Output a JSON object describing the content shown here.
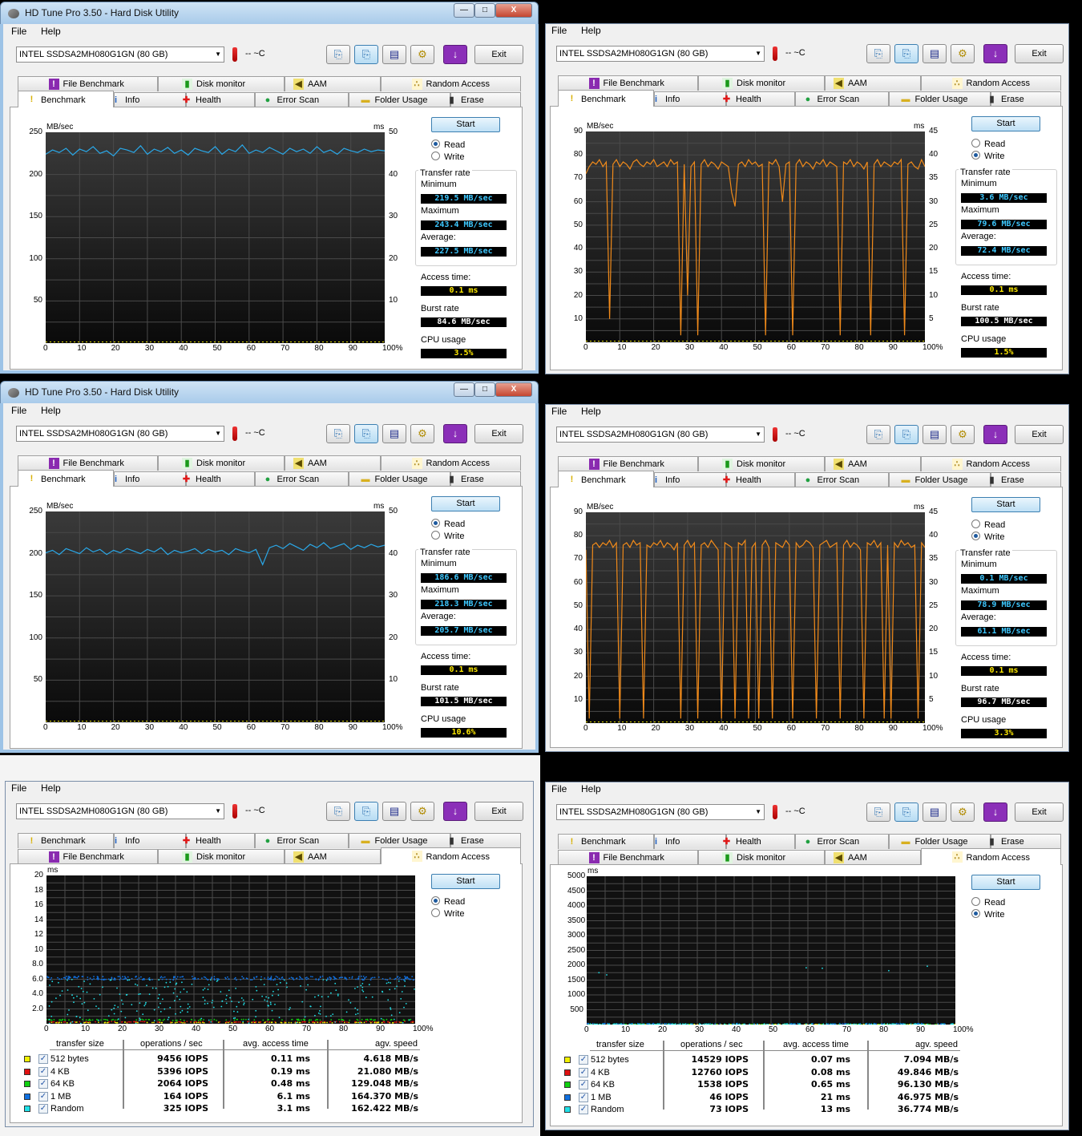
{
  "window_title": "HD Tune Pro 3.50 - Hard Disk Utility",
  "window_buttons": {
    "minimize": "—",
    "maximize": "□",
    "close": "X"
  },
  "menu": {
    "file": "File",
    "help": "Help"
  },
  "toolbar": {
    "drive": "INTEL SSDSA2MH080G1GN (80 GB)",
    "temp": "-- ~C",
    "exit": "Exit",
    "save_icon_glyph": "▤",
    "download_glyph": "↓"
  },
  "tabs": {
    "row_a": [
      "File Benchmark",
      "Disk monitor",
      "AAM",
      "Random Access"
    ],
    "row_b": [
      "Benchmark",
      "Info",
      "Health",
      "Error Scan",
      "Folder Usage",
      "Erase"
    ]
  },
  "labels": {
    "start": "Start",
    "read": "Read",
    "write": "Write",
    "transfer_rate": "Transfer rate",
    "minimum": "Minimum",
    "maximum": "Maximum",
    "average": "Average:",
    "access_time": "Access time:",
    "burst_rate": "Burst rate",
    "cpu_usage": "CPU usage",
    "mbsec": "MB/sec",
    "ms": "ms",
    "col_size": "transfer size",
    "col_ops": "operations / sec",
    "col_access": "avg. access time",
    "col_speed": "agv. speed"
  },
  "colors": {
    "read_line": "#2aa8e8",
    "write_line": "#f08a1a",
    "access_dots": "#e8e000"
  },
  "panels": [
    {
      "type": "benchmark",
      "mode": "read",
      "stats": {
        "min": "219.5 MB/sec",
        "max": "243.4 MB/sec",
        "avg": "227.5 MB/sec",
        "access": "0.1 ms",
        "burst": "84.6 MB/sec",
        "cpu": "3.5%"
      }
    },
    {
      "type": "benchmark",
      "mode": "write",
      "stats": {
        "min": "3.6 MB/sec",
        "max": "79.6 MB/sec",
        "avg": "72.4 MB/sec",
        "access": "0.1 ms",
        "burst": "100.5 MB/sec",
        "cpu": "1.5%"
      }
    },
    {
      "type": "benchmark",
      "mode": "read",
      "stats": {
        "min": "186.6 MB/sec",
        "max": "218.3 MB/sec",
        "avg": "205.7 MB/sec",
        "access": "0.1 ms",
        "burst": "101.5 MB/sec",
        "cpu": "10.6%"
      }
    },
    {
      "type": "benchmark",
      "mode": "write",
      "stats": {
        "min": "0.1 MB/sec",
        "max": "78.9 MB/sec",
        "avg": "61.1 MB/sec",
        "access": "0.1 ms",
        "burst": "96.7 MB/sec",
        "cpu": "3.3%"
      }
    },
    {
      "type": "random",
      "mode": "read",
      "rows": [
        {
          "size": "512 bytes",
          "color": "#f0f000",
          "ops": "9456 IOPS",
          "access": "0.11 ms",
          "speed": "4.618 MB/s"
        },
        {
          "size": "4 KB",
          "color": "#e01010",
          "ops": "5396 IOPS",
          "access": "0.19 ms",
          "speed": "21.080 MB/s"
        },
        {
          "size": "64 KB",
          "color": "#10d010",
          "ops": "2064 IOPS",
          "access": "0.48 ms",
          "speed": "129.048 MB/s"
        },
        {
          "size": "1 MB",
          "color": "#1070e0",
          "ops": "164 IOPS",
          "access": "6.1 ms",
          "speed": "164.370 MB/s"
        },
        {
          "size": "Random",
          "color": "#20e0e8",
          "ops": "325 IOPS",
          "access": "3.1 ms",
          "speed": "162.422 MB/s"
        }
      ]
    },
    {
      "type": "random",
      "mode": "write",
      "rows": [
        {
          "size": "512 bytes",
          "color": "#f0f000",
          "ops": "14529 IOPS",
          "access": "0.07 ms",
          "speed": "7.094 MB/s"
        },
        {
          "size": "4 KB",
          "color": "#e01010",
          "ops": "12760 IOPS",
          "access": "0.08 ms",
          "speed": "49.846 MB/s"
        },
        {
          "size": "64 KB",
          "color": "#10d010",
          "ops": "1538 IOPS",
          "access": "0.65 ms",
          "speed": "96.130 MB/s"
        },
        {
          "size": "1 MB",
          "color": "#1070e0",
          "ops": "46 IOPS",
          "access": "21 ms",
          "speed": "46.975 MB/s"
        },
        {
          "size": "Random",
          "color": "#20e0e8",
          "ops": "73 IOPS",
          "access": "13 ms",
          "speed": "36.774 MB/s"
        }
      ]
    }
  ],
  "chart_data": [
    {
      "type": "line",
      "title": "Benchmark Read",
      "ylabel": "MB/sec",
      "y2label": "ms",
      "ylim": [
        0,
        250
      ],
      "y2lim": [
        0,
        50
      ],
      "yticks": [
        "50",
        "100",
        "150",
        "200",
        "250"
      ],
      "y2ticks": [
        "10",
        "20",
        "30",
        "40",
        "50"
      ],
      "xticks": [
        "0",
        "10",
        "20",
        "30",
        "40",
        "50",
        "60",
        "70",
        "80",
        "90",
        "100%"
      ],
      "x_step": 2,
      "values": [
        224,
        229,
        226,
        231,
        223,
        230,
        227,
        233,
        225,
        228,
        222,
        231,
        229,
        226,
        234,
        224,
        230,
        227,
        232,
        225,
        229,
        223,
        231,
        228,
        226,
        233,
        224,
        230,
        227,
        235,
        225,
        229,
        226,
        232,
        228,
        224,
        231,
        227,
        230,
        225,
        233,
        226,
        229,
        224,
        231,
        228,
        226,
        230,
        227,
        229,
        228
      ]
    },
    {
      "type": "line",
      "title": "Benchmark Write",
      "ylabel": "MB/sec",
      "y2label": "ms",
      "ylim": [
        0,
        90
      ],
      "y2lim": [
        0,
        45
      ],
      "yticks": [
        "10",
        "20",
        "30",
        "40",
        "50",
        "60",
        "70",
        "80",
        "90"
      ],
      "y2ticks": [
        "5",
        "10",
        "15",
        "20",
        "25",
        "30",
        "35",
        "40",
        "45"
      ],
      "xticks": [
        "0",
        "10",
        "20",
        "30",
        "40",
        "50",
        "60",
        "70",
        "80",
        "90",
        "100%"
      ],
      "x_step": 1,
      "values": [
        72,
        75,
        77,
        76,
        78,
        75,
        77,
        10,
        76,
        78,
        75,
        77,
        76,
        74,
        77,
        78,
        76,
        75,
        77,
        76,
        78,
        75,
        76,
        77,
        75,
        78,
        76,
        77,
        3,
        76,
        20,
        75,
        77,
        3,
        76,
        78,
        75,
        77,
        76,
        74,
        77,
        76,
        75,
        64,
        58,
        76,
        77,
        75,
        78,
        76,
        77,
        75,
        76,
        3,
        77,
        76,
        78,
        75,
        60,
        76,
        77,
        3,
        76,
        78,
        75,
        77,
        76,
        74,
        77,
        76,
        78,
        75,
        77,
        76,
        75,
        3,
        77,
        76,
        78,
        75,
        77,
        76,
        74,
        77,
        3,
        76,
        78,
        75,
        77,
        76,
        75,
        77,
        76,
        78,
        3,
        76,
        77,
        75,
        74,
        78,
        75
      ]
    },
    {
      "type": "line",
      "title": "Benchmark Read",
      "ylabel": "MB/sec",
      "y2label": "ms",
      "ylim": [
        0,
        250
      ],
      "y2lim": [
        0,
        50
      ],
      "yticks": [
        "50",
        "100",
        "150",
        "200",
        "250"
      ],
      "y2ticks": [
        "10",
        "20",
        "30",
        "40",
        "50"
      ],
      "xticks": [
        "0",
        "10",
        "20",
        "30",
        "40",
        "50",
        "60",
        "70",
        "80",
        "90",
        "100%"
      ],
      "x_step": 2,
      "values": [
        201,
        204,
        199,
        206,
        203,
        200,
        207,
        202,
        205,
        199,
        204,
        201,
        206,
        203,
        200,
        205,
        202,
        207,
        199,
        204,
        201,
        203,
        206,
        200,
        205,
        202,
        204,
        199,
        206,
        203,
        201,
        205,
        187,
        207,
        210,
        206,
        212,
        208,
        204,
        211,
        207,
        213,
        206,
        209,
        212,
        205,
        210,
        207,
        211,
        208,
        210
      ]
    },
    {
      "type": "line",
      "title": "Benchmark Write",
      "ylabel": "MB/sec",
      "y2label": "ms",
      "ylim": [
        0,
        90
      ],
      "y2lim": [
        0,
        45
      ],
      "yticks": [
        "10",
        "20",
        "30",
        "40",
        "50",
        "60",
        "70",
        "80",
        "90"
      ],
      "y2ticks": [
        "5",
        "10",
        "15",
        "20",
        "25",
        "30",
        "35",
        "40",
        "45"
      ],
      "xticks": [
        "0",
        "10",
        "20",
        "30",
        "40",
        "50",
        "60",
        "70",
        "80",
        "90",
        "100%"
      ],
      "x_step": 1,
      "values": [
        74,
        2,
        76,
        77,
        75,
        77,
        76,
        78,
        75,
        77,
        2,
        76,
        77,
        75,
        78,
        76,
        77,
        2,
        76,
        75,
        77,
        76,
        78,
        75,
        77,
        76,
        74,
        77,
        2,
        76,
        78,
        75,
        77,
        2,
        76,
        77,
        75,
        78,
        76,
        74,
        2,
        77,
        76,
        75,
        2,
        77,
        76,
        78,
        2,
        75,
        77,
        2,
        76,
        78,
        75,
        2,
        77,
        76,
        75,
        78,
        76,
        2,
        77,
        75,
        76,
        78,
        77,
        75,
        2,
        76,
        77,
        78,
        75,
        76,
        77,
        2,
        76,
        78,
        75,
        77,
        76,
        74,
        2,
        77,
        76,
        78,
        75,
        77,
        2,
        76,
        2,
        77,
        75,
        78,
        76,
        77,
        75,
        76,
        2,
        77,
        75
      ]
    },
    {
      "type": "scatter",
      "title": "Random Access Read",
      "ylabel": "ms",
      "ylim": [
        0,
        20
      ],
      "yticks": [
        "2.0",
        "4.0",
        "6.0",
        "8.0",
        "10",
        "12",
        "14",
        "16",
        "18",
        "20"
      ],
      "xticks": [
        "0",
        "10",
        "20",
        "30",
        "40",
        "50",
        "60",
        "70",
        "80",
        "90",
        "100%"
      ],
      "series": [
        {
          "name": "512 bytes",
          "avg_ms": 0.11
        },
        {
          "name": "4 KB",
          "avg_ms": 0.19
        },
        {
          "name": "64 KB",
          "avg_ms": 0.48
        },
        {
          "name": "1 MB",
          "avg_ms": 6.1
        },
        {
          "name": "Random",
          "avg_ms": 3.1
        }
      ]
    },
    {
      "type": "scatter",
      "title": "Random Access Write",
      "ylabel": "ms",
      "ylim": [
        0,
        5000
      ],
      "yticks": [
        "500",
        "1000",
        "1500",
        "2000",
        "2500",
        "3000",
        "3500",
        "4000",
        "4500",
        "5000"
      ],
      "xticks": [
        "0",
        "10",
        "20",
        "30",
        "40",
        "50",
        "60",
        "70",
        "80",
        "90",
        "100%"
      ],
      "series": [
        {
          "name": "512 bytes",
          "avg_ms": 0.07
        },
        {
          "name": "4 KB",
          "avg_ms": 0.08
        },
        {
          "name": "64 KB",
          "avg_ms": 0.65
        },
        {
          "name": "1 MB",
          "avg_ms": 21
        },
        {
          "name": "Random",
          "avg_ms": 13
        }
      ]
    }
  ]
}
